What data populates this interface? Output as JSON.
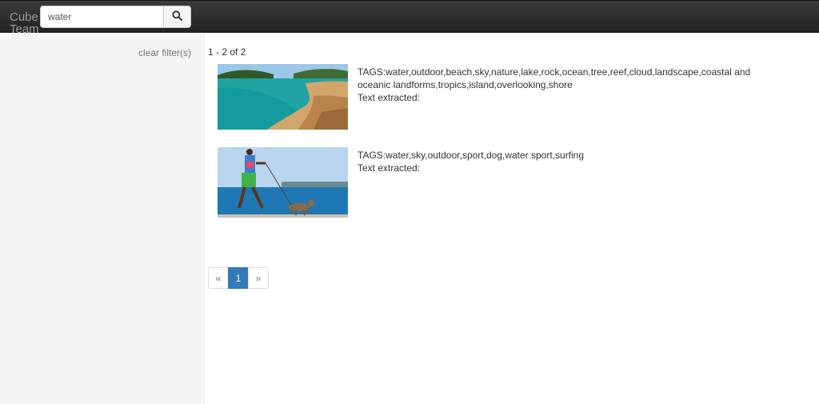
{
  "navbar": {
    "brand": "Cube Team",
    "search": {
      "value": "water",
      "placeholder": ""
    },
    "search_icon": "search-icon"
  },
  "sidebar": {
    "clear_filters": "clear filter(s)"
  },
  "results": {
    "count_text": "1 - 2 of 2",
    "items": [
      {
        "tags": "TAGS:water,outdoor,beach,sky,nature,lake,rock,ocean,tree,reef,cloud,landscape,coastal and oceanic landforms,tropics,island,overlooking,shore",
        "text_extracted": "Text extracted:"
      },
      {
        "tags": "TAGS:water,sky,outdoor,sport,dog,water sport,surfing",
        "text_extracted": "Text extracted:"
      }
    ]
  },
  "pagination": {
    "prev": "«",
    "current": "1",
    "next": "»"
  },
  "colors": {
    "navbar": "#222222",
    "accent": "#337ab7",
    "sidebar": "#f5f5f5"
  }
}
